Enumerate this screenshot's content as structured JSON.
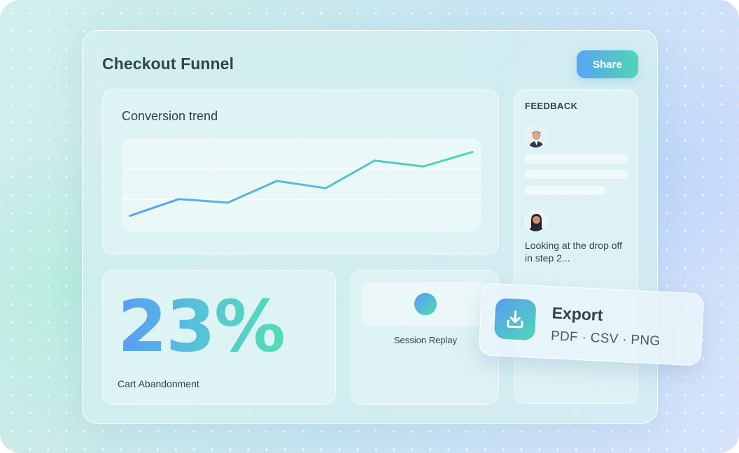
{
  "page": {
    "title": "Checkout Funnel",
    "share_label": "Share"
  },
  "trend": {
    "title": "Conversion trend"
  },
  "chart_data": {
    "type": "line",
    "x": [
      1,
      2,
      3,
      4,
      5,
      6,
      7,
      8
    ],
    "series": [
      {
        "values": [
          0.12,
          0.35,
          0.3,
          0.6,
          0.5,
          0.88,
          0.8,
          1.0
        ]
      }
    ],
    "ylim": [
      0,
      1.1
    ],
    "grid": true,
    "line_gradient": [
      "#5aa3f4",
      "#4fd6b4"
    ]
  },
  "stat": {
    "value": "23%",
    "label": "Cart Abandonment"
  },
  "replay": {
    "label": "Session Replay"
  },
  "feedback": {
    "heading": "FEEDBACK",
    "comment": "Looking at the drop off in step 2..."
  },
  "export": {
    "title": "Export",
    "formats": "PDF · CSV · PNG",
    "icon": "download-icon"
  },
  "colors": {
    "accent_blue": "#5aa3f4",
    "accent_green": "#4fd6b4",
    "text": "#34424f"
  }
}
